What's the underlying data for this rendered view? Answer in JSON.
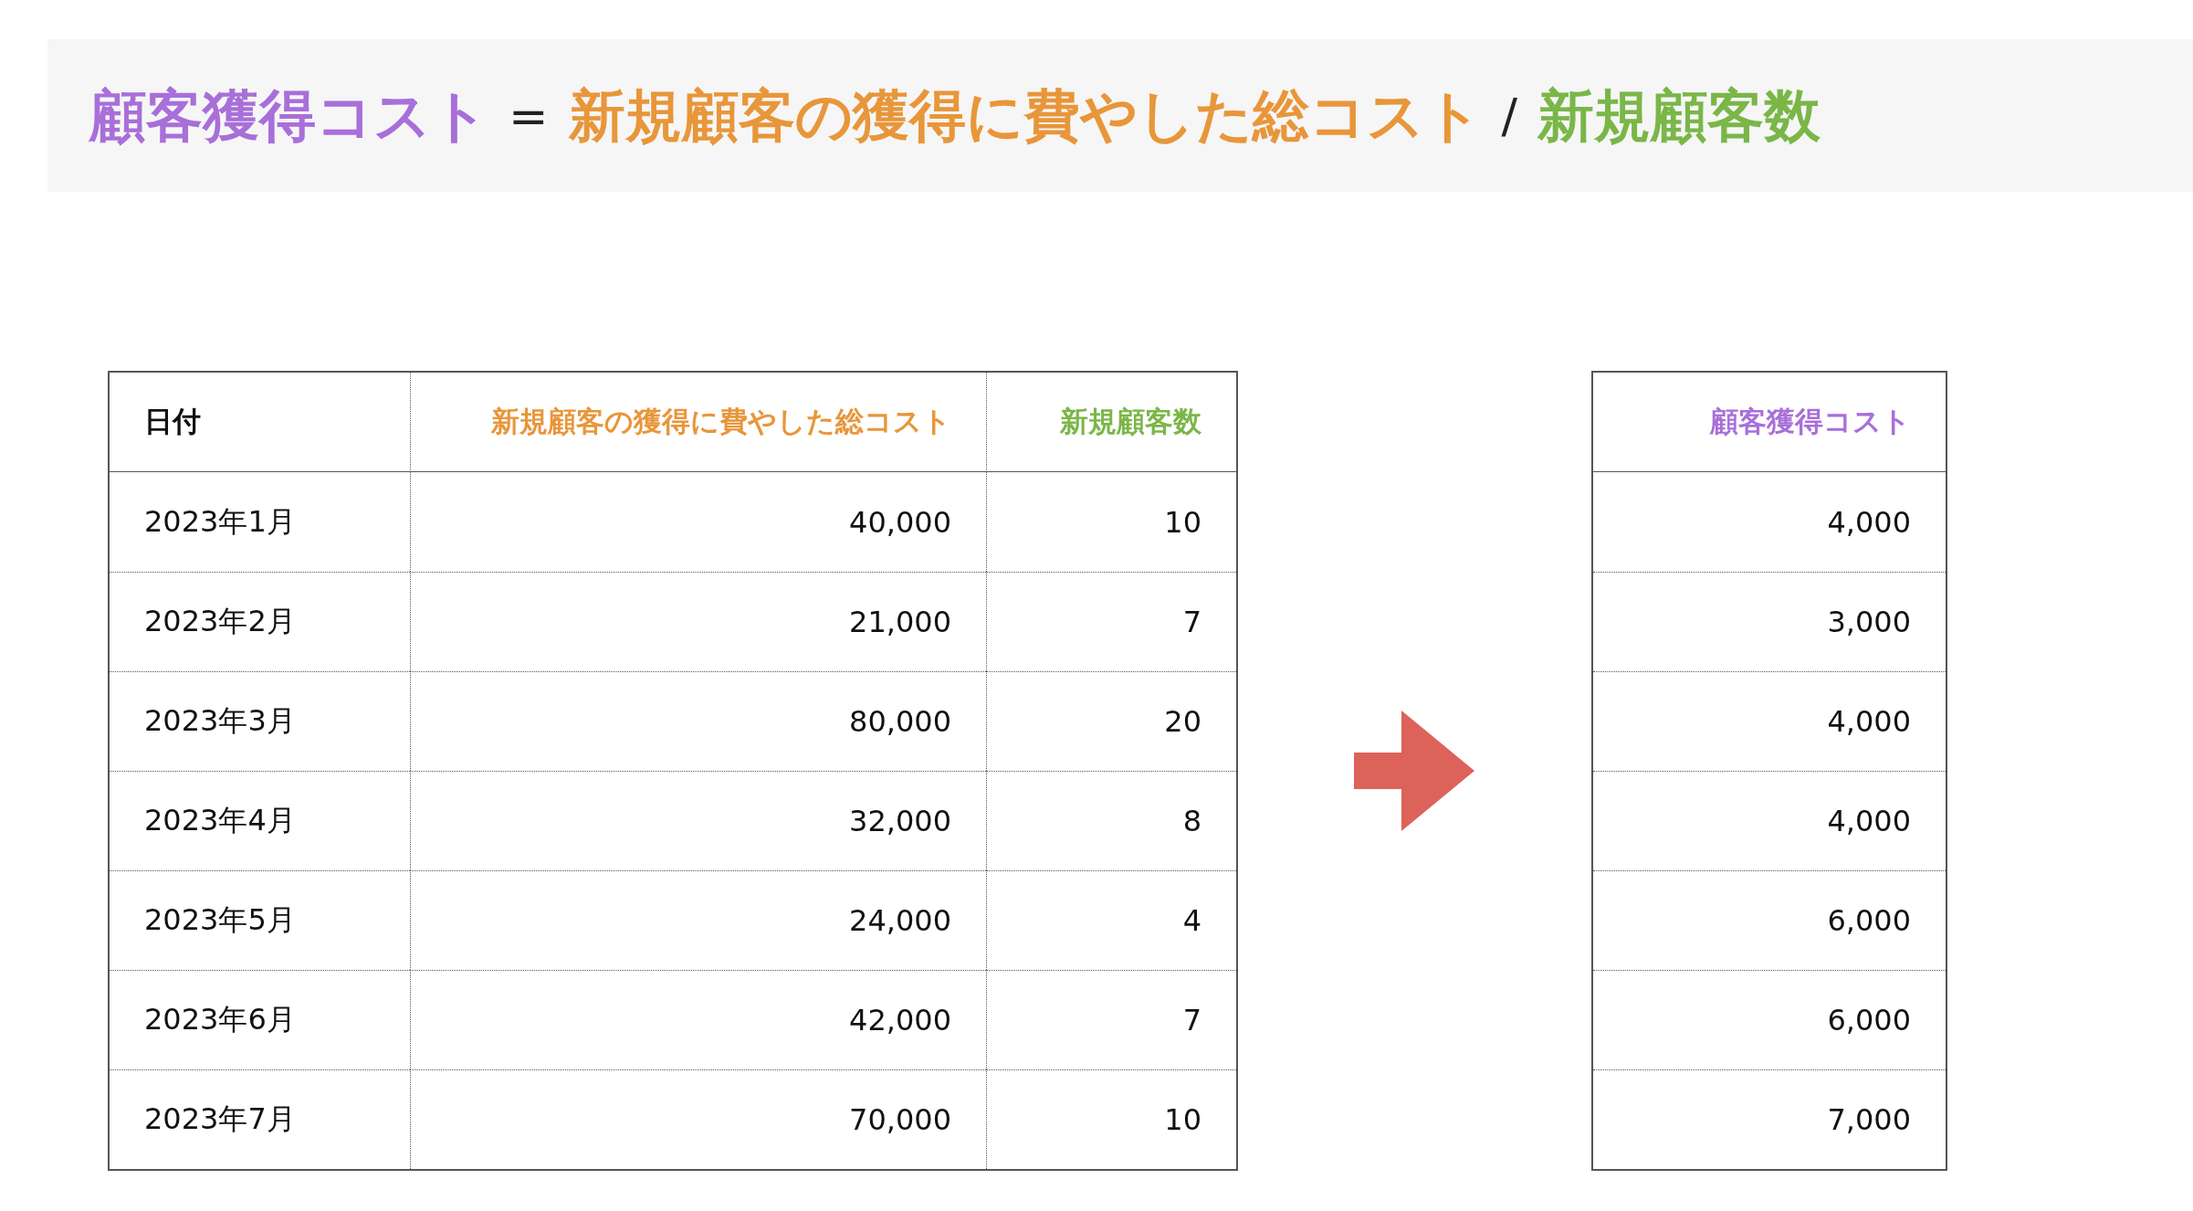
{
  "formula": [
    {
      "kind": "term",
      "text": "顧客獲得コスト",
      "color": "#a86fd9"
    },
    {
      "kind": "operator",
      "text": "="
    },
    {
      "kind": "term",
      "text": "新規顧客の獲得に費やした総コスト",
      "color": "#e8963a"
    },
    {
      "kind": "operator",
      "text": "/"
    },
    {
      "kind": "term",
      "text": "新規顧客数",
      "color": "#7ab648"
    }
  ],
  "input_table": {
    "columns": [
      {
        "label": "日付",
        "color": "#111111"
      },
      {
        "label": "新規顧客の獲得に費やした総コスト",
        "color": "#e8963a"
      },
      {
        "label": "新規顧客数",
        "color": "#7ab648"
      }
    ],
    "rows": [
      [
        "2023年1月",
        "40,000",
        "10"
      ],
      [
        "2023年2月",
        "21,000",
        "7"
      ],
      [
        "2023年3月",
        "80,000",
        "20"
      ],
      [
        "2023年4月",
        "32,000",
        "8"
      ],
      [
        "2023年5月",
        "24,000",
        "4"
      ],
      [
        "2023年6月",
        "42,000",
        "7"
      ],
      [
        "2023年7月",
        "70,000",
        "10"
      ]
    ]
  },
  "result_table": {
    "column": {
      "label": "顧客獲得コスト",
      "color": "#a86fd9"
    },
    "rows": [
      "4,000",
      "3,000",
      "4,000",
      "4,000",
      "6,000",
      "6,000",
      "7,000"
    ]
  }
}
